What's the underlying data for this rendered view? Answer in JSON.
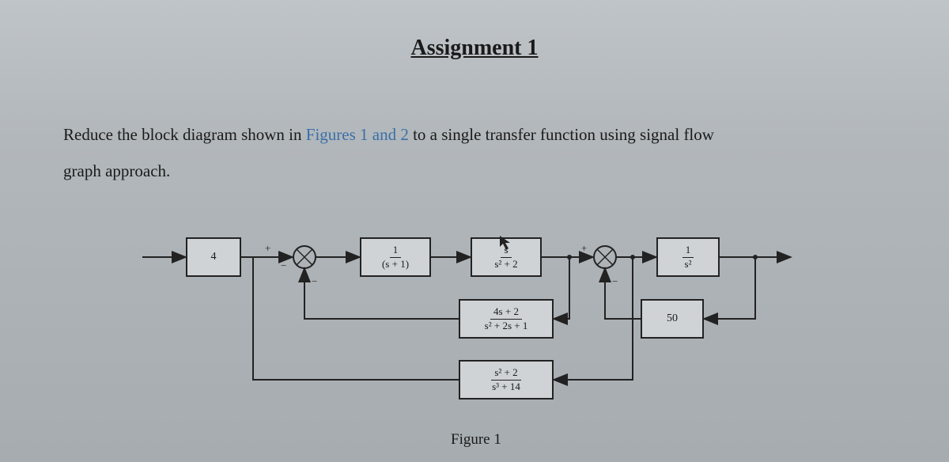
{
  "title": "Assignment 1",
  "problem_text_a": "Reduce the block diagram shown in ",
  "problem_figures": "Figures 1 and 2",
  "problem_text_b": " to a single transfer function using signal flow",
  "problem_text_c": "graph approach.",
  "caption": "Figure 1",
  "blocks": {
    "g0": {
      "single": "4"
    },
    "g1": {
      "num": "1",
      "den": "(s + 1)"
    },
    "g2": {
      "num": "s",
      "den": "s² + 2"
    },
    "g3": {
      "num": "1",
      "den": "s²"
    },
    "h1": {
      "num": "4s + 2",
      "den": "s² + 2s + 1"
    },
    "h2": {
      "single": "50"
    },
    "h3": {
      "num": "s² + 2",
      "den": "s³ + 14"
    }
  }
}
